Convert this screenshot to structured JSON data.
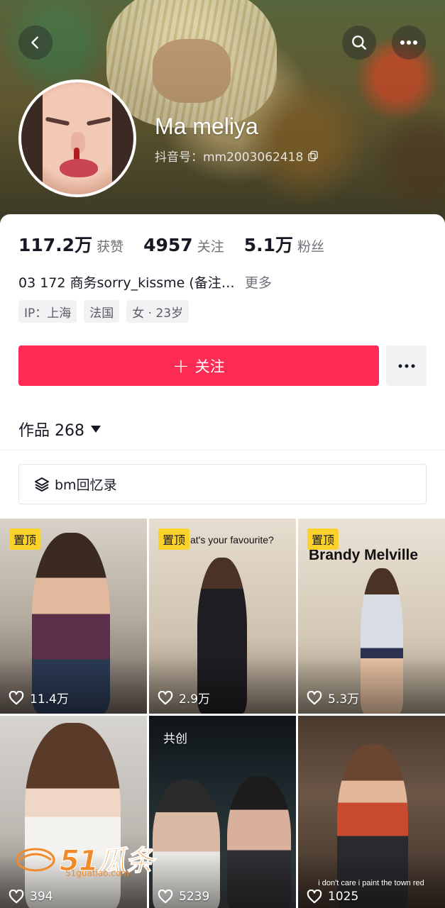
{
  "header": {
    "back_icon": "chevron-left-icon",
    "search_icon": "search-icon",
    "more_icon": "ellipsis-icon"
  },
  "profile": {
    "nickname": "Ma meliya",
    "douyin_id": "抖音号：mm2003062418",
    "copy_icon": "copy-icon"
  },
  "stats": [
    {
      "num": "117.2万",
      "label": "获赞"
    },
    {
      "num": "4957",
      "label": "关注"
    },
    {
      "num": "5.1万",
      "label": "粉丝"
    }
  ],
  "bio": {
    "text": "03 172  商务sorry_kissme (备注…",
    "more": "更多"
  },
  "tags": [
    "IP：上海",
    "法国",
    "女 · 23岁"
  ],
  "actions": {
    "follow_label": "关注",
    "follow_plus": "+"
  },
  "works": {
    "label": "作品 268"
  },
  "collection": {
    "label": "bm回忆录",
    "icon": "layers-icon"
  },
  "videos": [
    {
      "pinned": true,
      "badge": "置顶",
      "likes": "11.4万",
      "overlay": ""
    },
    {
      "pinned": true,
      "badge": "置顶",
      "likes": "2.9万",
      "overlay": "at's your favourite?"
    },
    {
      "pinned": true,
      "badge": "置顶",
      "likes": "5.3万",
      "overlay": "Brandy Melville"
    },
    {
      "pinned": false,
      "badge": "",
      "likes": "394",
      "overlay": ""
    },
    {
      "pinned": false,
      "badge": "共创",
      "likes": "5239",
      "overlay": ""
    },
    {
      "pinned": false,
      "badge": "",
      "likes": "1025",
      "overlay": "i don't care i paint the town red"
    }
  ],
  "watermark": {
    "main": "51瓜条",
    "sub": "51guatiao.com"
  },
  "colors": {
    "accent": "#fe2c55",
    "pin": "#fbd12c",
    "text": "#161823",
    "muted": "#6f7078"
  }
}
